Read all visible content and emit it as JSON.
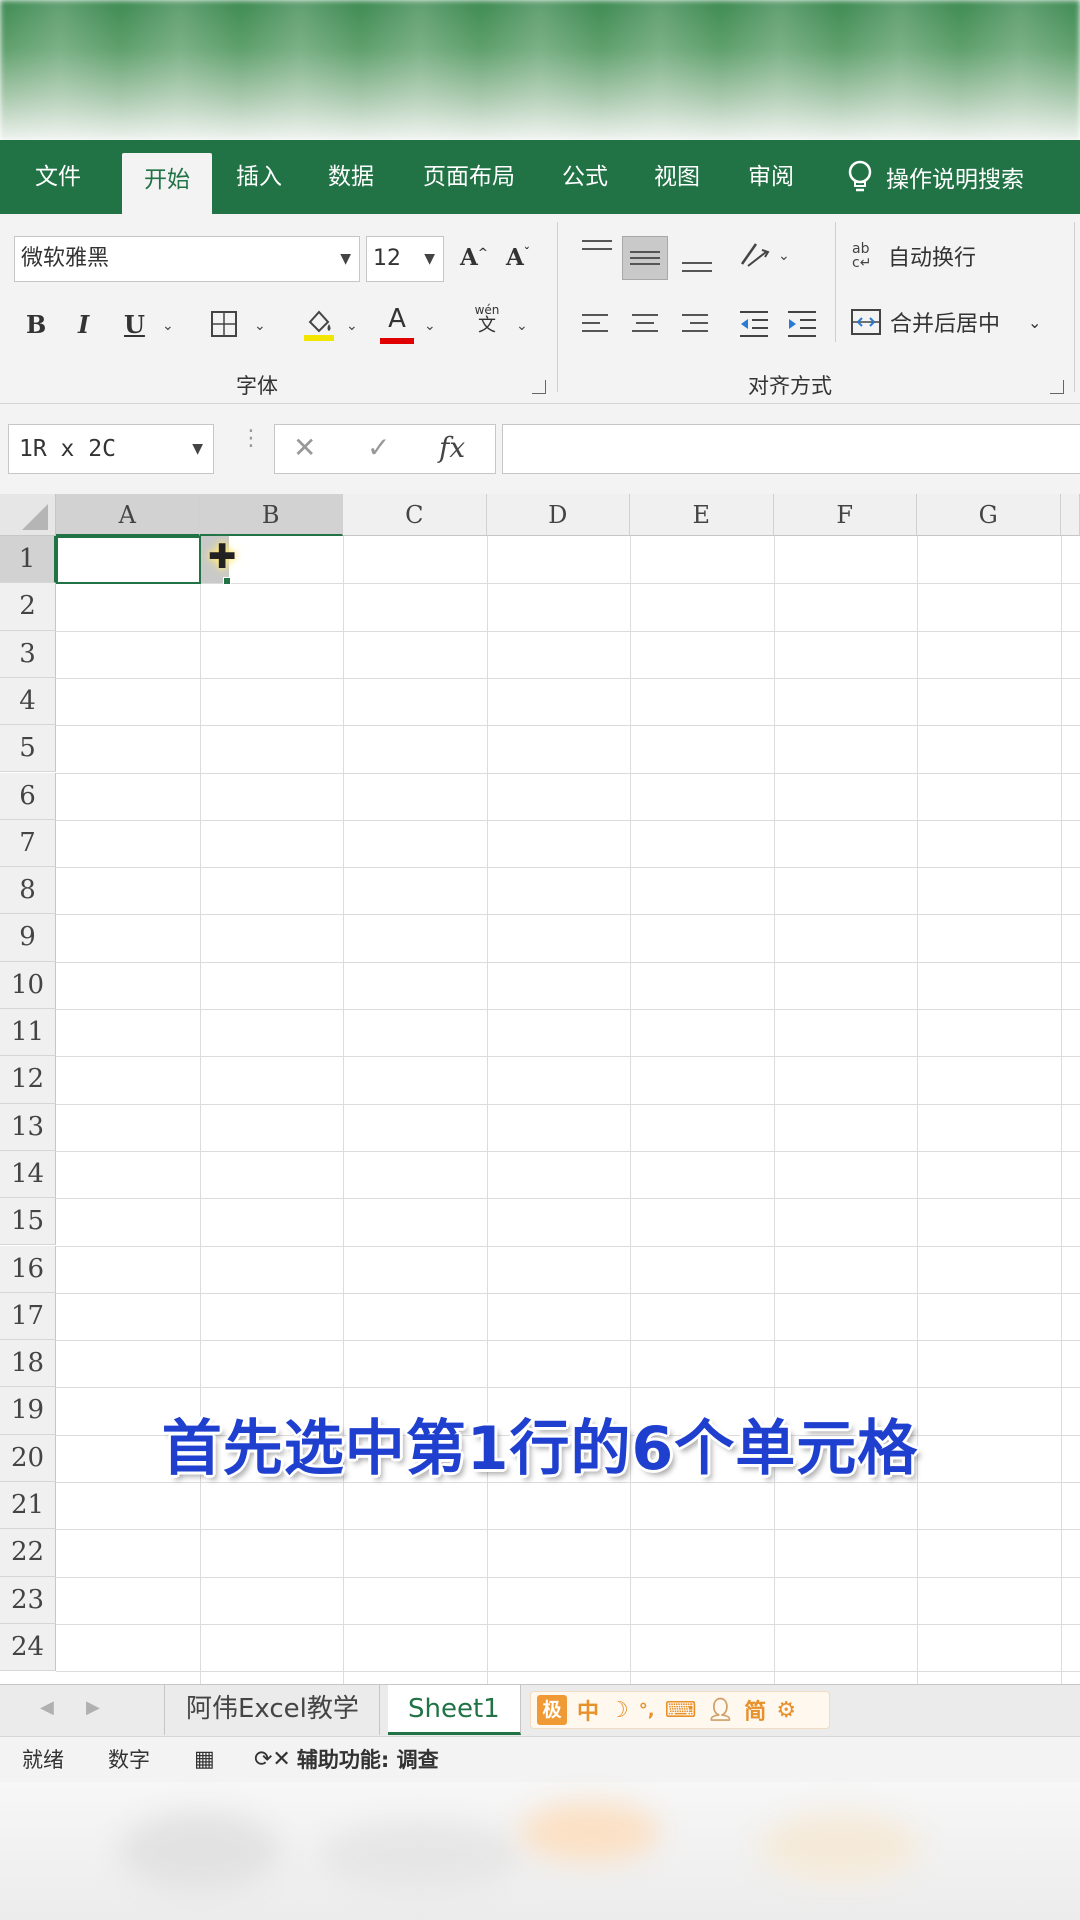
{
  "ribbon_tabs": [
    {
      "label": "文件",
      "active": false
    },
    {
      "label": "开始",
      "active": true
    },
    {
      "label": "插入",
      "active": false
    },
    {
      "label": "数据",
      "active": false
    },
    {
      "label": "页面布局",
      "active": false
    },
    {
      "label": "公式",
      "active": false
    },
    {
      "label": "视图",
      "active": false
    },
    {
      "label": "审阅",
      "active": false
    }
  ],
  "search_label": "操作说明搜索",
  "font": {
    "name": "微软雅黑",
    "size": "12",
    "group_label": "字体"
  },
  "format_buttons": {
    "bold": "B",
    "italic": "I",
    "underline": "U",
    "grow": "A",
    "shrink": "A",
    "phonetic_top": "wén",
    "phonetic_bottom": "文",
    "font_color": "A"
  },
  "alignment": {
    "wrap_text": "自动换行",
    "wrap_icon": "ab",
    "merge_center": "合并后居中",
    "group_label": "对齐方式"
  },
  "formula_bar": {
    "name_box": "1R x 2C",
    "fx": "fx",
    "cancel": "✕",
    "enter": "✓",
    "value": ""
  },
  "columns": [
    "A",
    "B",
    "C",
    "D",
    "E",
    "F",
    "G"
  ],
  "rows": [
    "1",
    "2",
    "3",
    "4",
    "5",
    "6",
    "7",
    "8",
    "9",
    "10",
    "11",
    "12",
    "13",
    "14",
    "15",
    "16",
    "17",
    "18",
    "19",
    "20",
    "21",
    "22",
    "23",
    "24"
  ],
  "caption": "首先选中第1行的6个单元格",
  "sheet_tabs": [
    {
      "label": "阿伟Excel教学",
      "active": false
    },
    {
      "label": "Sheet1",
      "active": true
    }
  ],
  "ime": {
    "logo": "极",
    "mode": "中",
    "simplified": "简"
  },
  "status": {
    "ready": "就绪",
    "numlock": "数字",
    "accessibility": "辅助功能: 调查"
  },
  "colors": {
    "excel_green": "#217346",
    "caption_blue": "#1f3fcf"
  }
}
